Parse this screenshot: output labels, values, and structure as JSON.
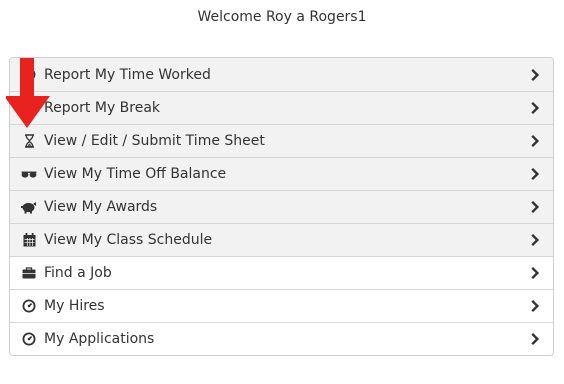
{
  "header": {
    "welcome": "Welcome Roy a Rogers1"
  },
  "menu": {
    "items": [
      {
        "label": "Report My Time Worked",
        "icon": "clock-icon",
        "shaded": true
      },
      {
        "label": "Report My Break",
        "icon": "coffee-icon",
        "shaded": true
      },
      {
        "label": "View / Edit / Submit Time Sheet",
        "icon": "hourglass-icon",
        "shaded": true
      },
      {
        "label": "View My Time Off Balance",
        "icon": "sunglasses-icon",
        "shaded": true
      },
      {
        "label": "View My Awards",
        "icon": "piggy-bank-icon",
        "shaded": true
      },
      {
        "label": "View My Class Schedule",
        "icon": "calendar-icon",
        "shaded": true
      },
      {
        "label": "Find a Job",
        "icon": "briefcase-icon",
        "shaded": false
      },
      {
        "label": "My Hires",
        "icon": "dashboard-icon",
        "shaded": false
      },
      {
        "label": "My Applications",
        "icon": "dashboard-icon",
        "shaded": false
      }
    ]
  },
  "annotation": {
    "arrow_color": "#e8231f"
  }
}
